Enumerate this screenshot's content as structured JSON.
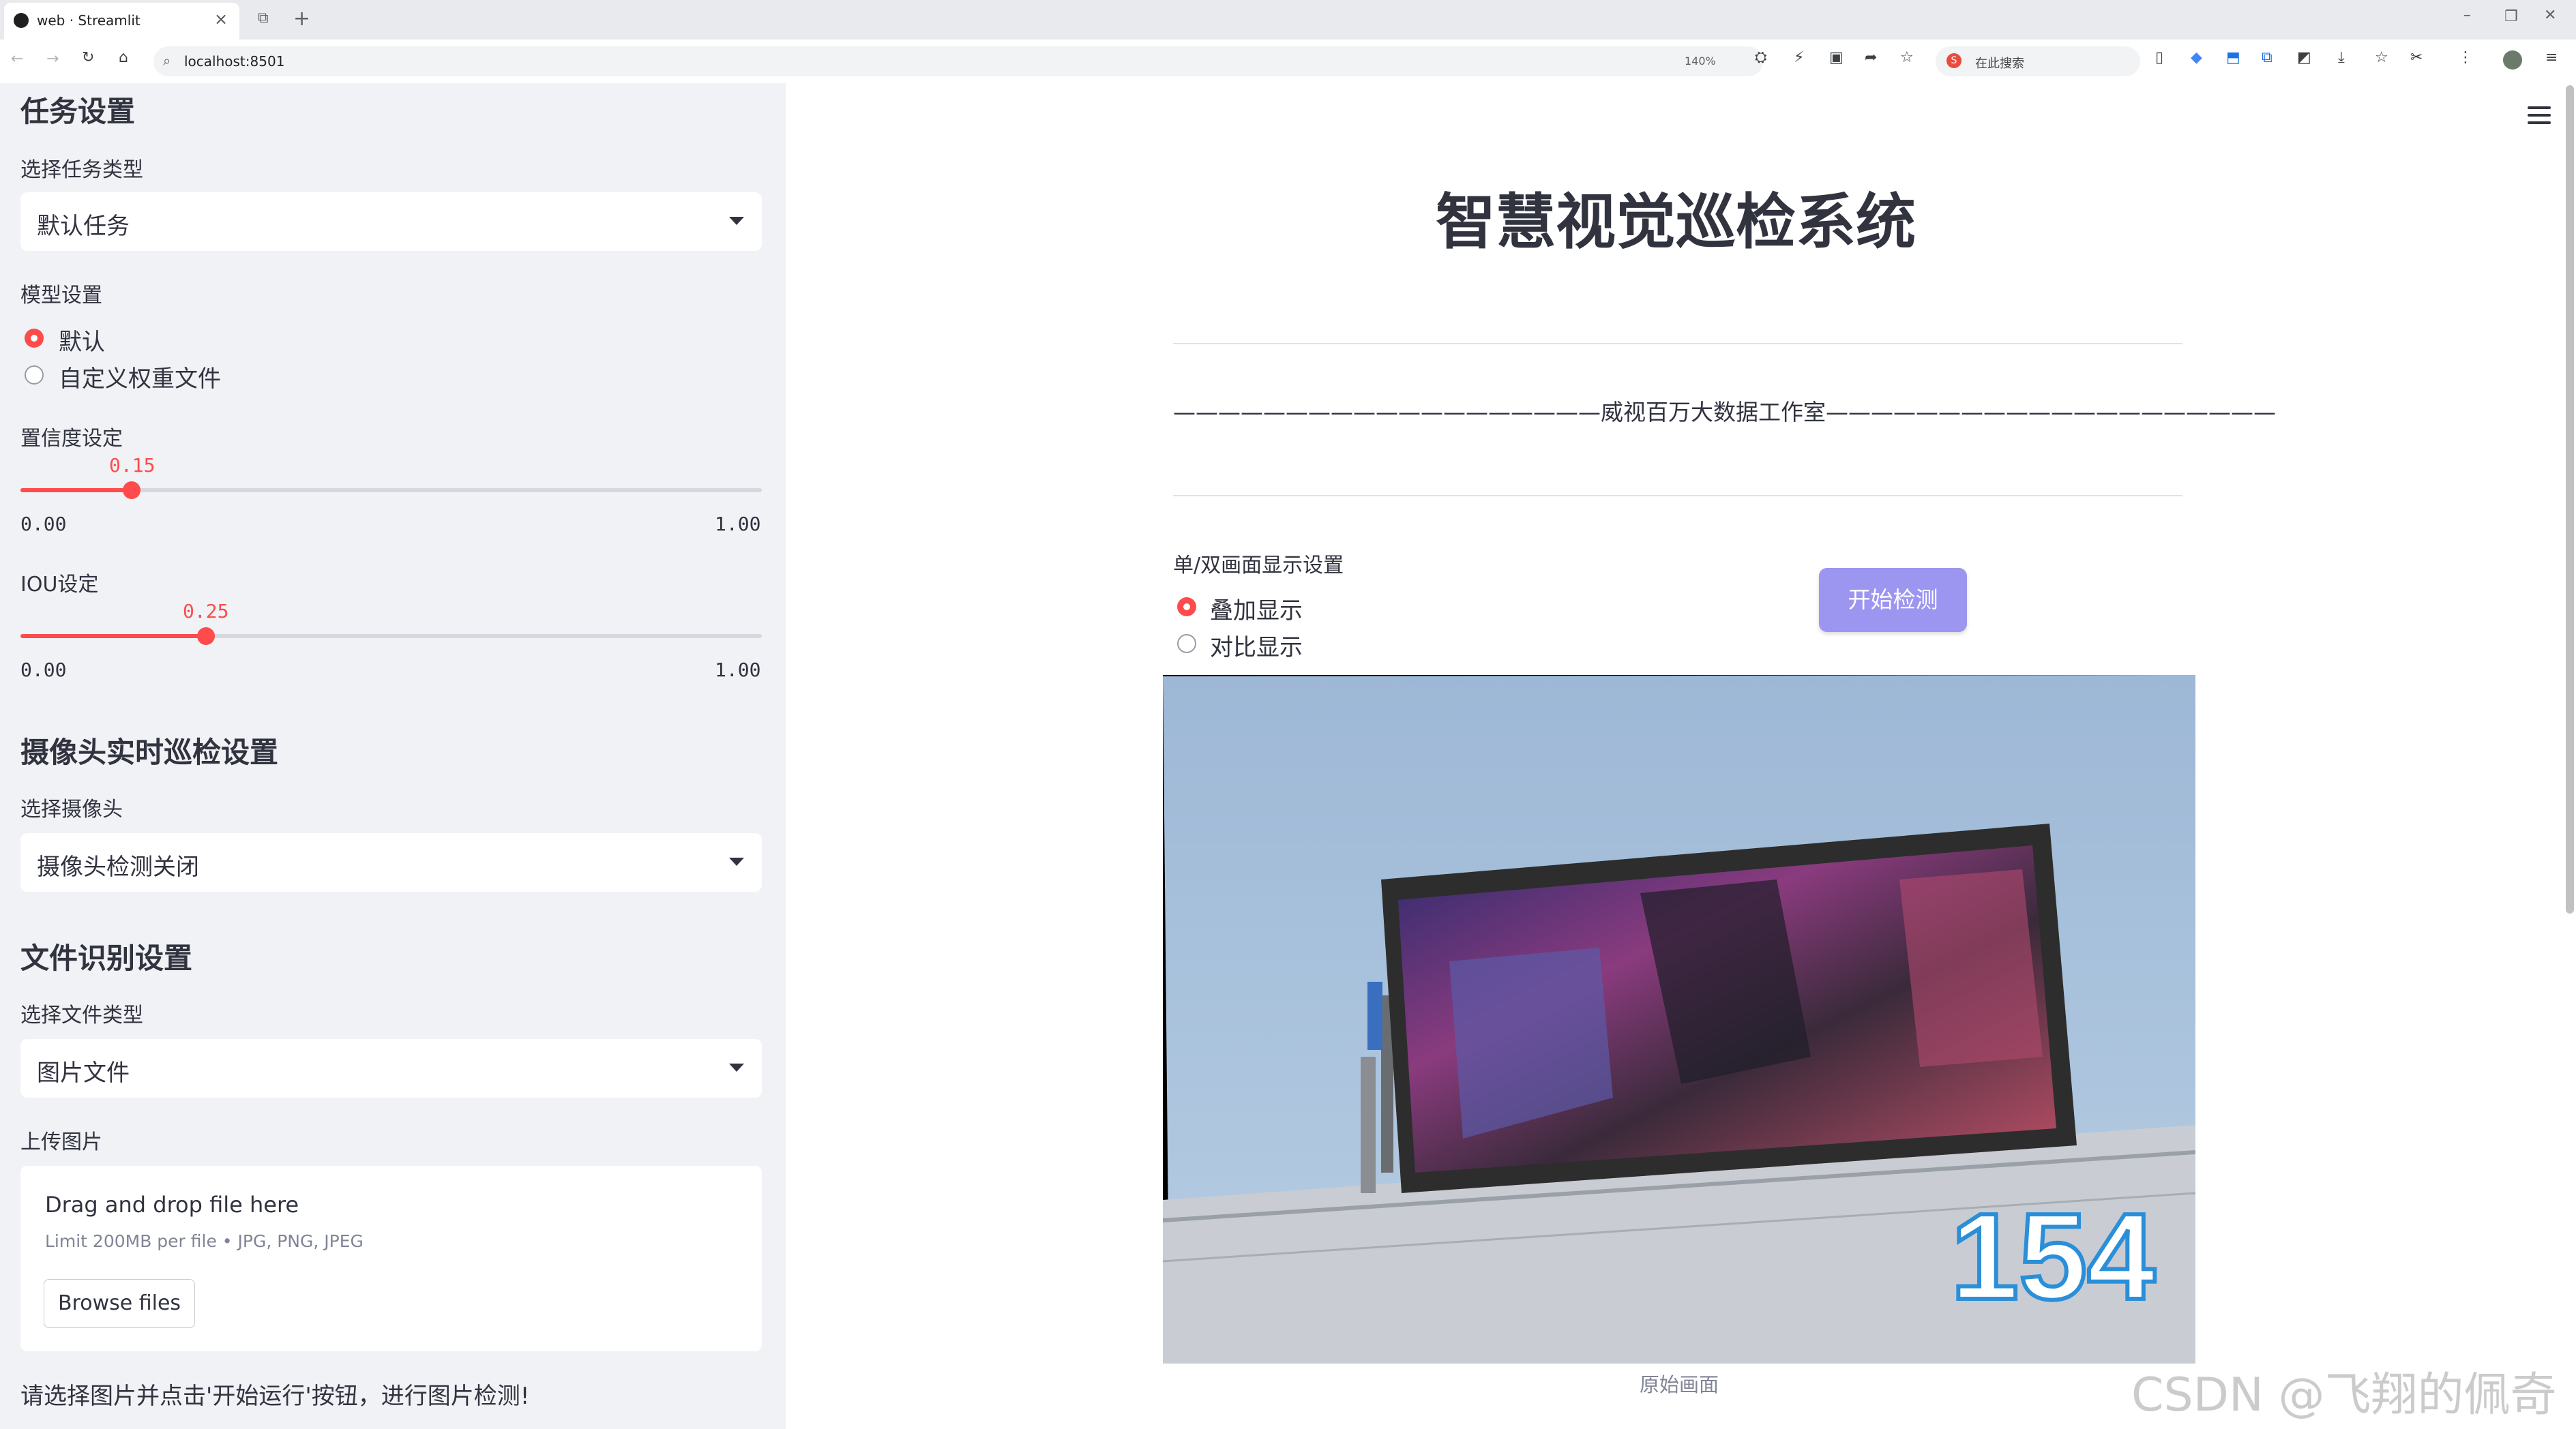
{
  "browser": {
    "tab_title": "web · Streamlit",
    "url": "localhost:8501",
    "zoom": "140%",
    "search_placeholder": "在此搜索"
  },
  "sidebar": {
    "task_section_title": "任务设置",
    "task_type_label": "选择任务类型",
    "task_type_value": "默认任务",
    "model_label": "模型设置",
    "model_options": [
      "默认",
      "自定义权重文件"
    ],
    "model_selected": 0,
    "conf_label": "置信度设定",
    "conf_value": "0.15",
    "conf_min": "0.00",
    "conf_max": "1.00",
    "conf_fraction": 0.15,
    "iou_label": "IOU设定",
    "iou_value": "0.25",
    "iou_min": "0.00",
    "iou_max": "1.00",
    "iou_fraction": 0.25,
    "camera_section_title": "摄像头实时巡检设置",
    "camera_label": "选择摄像头",
    "camera_value": "摄像头检测关闭",
    "file_section_title": "文件识别设置",
    "file_type_label": "选择文件类型",
    "file_type_value": "图片文件",
    "upload_label": "上传图片",
    "upload_drag_text": "Drag and drop file here",
    "upload_limit_text": "Limit 200MB per file • JPG, PNG, JPEG",
    "browse_label": "Browse files",
    "hint_text": "请选择图片并点击'开始运行'按钮，进行图片检测!"
  },
  "main": {
    "title": "智慧视觉巡检系统",
    "studio_line": "———————————————————威视百万大数据工作室————————————————————",
    "display_label": "单/双画面显示设置",
    "display_options": [
      "叠加显示",
      "对比显示"
    ],
    "display_selected": 0,
    "start_button": "开始检测",
    "image_number": "154",
    "image_caption": "原始画面"
  },
  "watermark": "CSDN @飞翔的佩奇",
  "colors": {
    "accent": "#ff4b4b",
    "button": "#9d96f0",
    "sidebar_bg": "#f0f2f6"
  }
}
